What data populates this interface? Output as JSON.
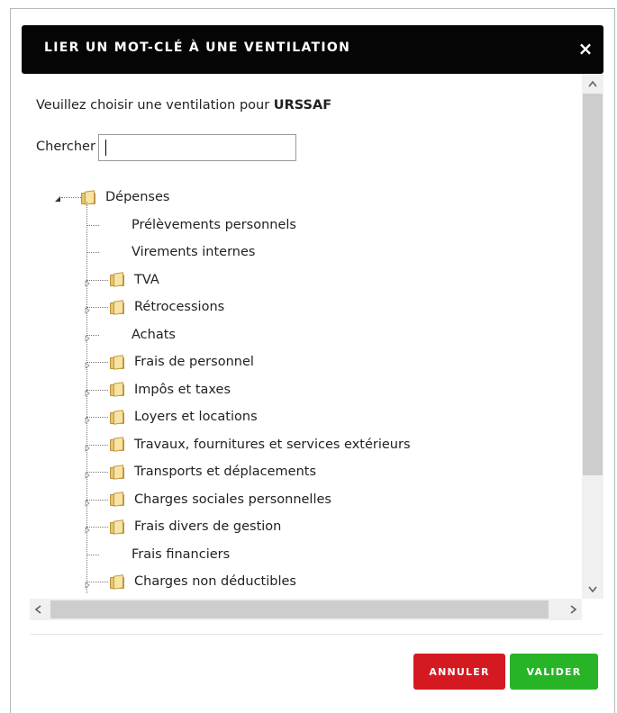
{
  "dialog": {
    "title": "LIER UN MOT-CLÉ À UNE VENTILATION",
    "close_icon": "×",
    "intro_text": "Veuillez choisir une ventilation pour ",
    "intro_entity": "URSSAF",
    "search_label": "Chercher",
    "search_value": "",
    "search_placeholder": ""
  },
  "tree": {
    "root": {
      "label": "Dépenses",
      "icon": "folder-open-icon",
      "expanded": true
    },
    "children": [
      {
        "label": "Prélèvements personnels",
        "folder": false,
        "expandable": false
      },
      {
        "label": "Virements internes",
        "folder": false,
        "expandable": false
      },
      {
        "label": "TVA",
        "folder": true,
        "expandable": true
      },
      {
        "label": "Rétrocessions",
        "folder": true,
        "expandable": true
      },
      {
        "label": "Achats",
        "folder": false,
        "expandable": true
      },
      {
        "label": "Frais de personnel",
        "folder": true,
        "expandable": true
      },
      {
        "label": "Impôs et taxes",
        "folder": true,
        "expandable": true
      },
      {
        "label": "Loyers et locations",
        "folder": true,
        "expandable": true
      },
      {
        "label": "Travaux, fournitures et services extérieurs",
        "folder": true,
        "expandable": true
      },
      {
        "label": "Transports et déplacements",
        "folder": true,
        "expandable": true
      },
      {
        "label": "Charges sociales personnelles",
        "folder": true,
        "expandable": true
      },
      {
        "label": "Frais divers de gestion",
        "folder": true,
        "expandable": true
      },
      {
        "label": "Frais financiers",
        "folder": false,
        "expandable": false
      },
      {
        "label": "Charges non déductibles",
        "folder": true,
        "expandable": true
      }
    ]
  },
  "scrollbars": {
    "up_arrow": "^",
    "down_arrow": "v",
    "left_arrow": "<",
    "right_arrow": ">"
  },
  "buttons": {
    "cancel_label": "ANNULER",
    "ok_label": "VALIDER"
  },
  "colors": {
    "title_bg": "#050505",
    "cancel": "#d41a20",
    "ok": "#27b427"
  }
}
